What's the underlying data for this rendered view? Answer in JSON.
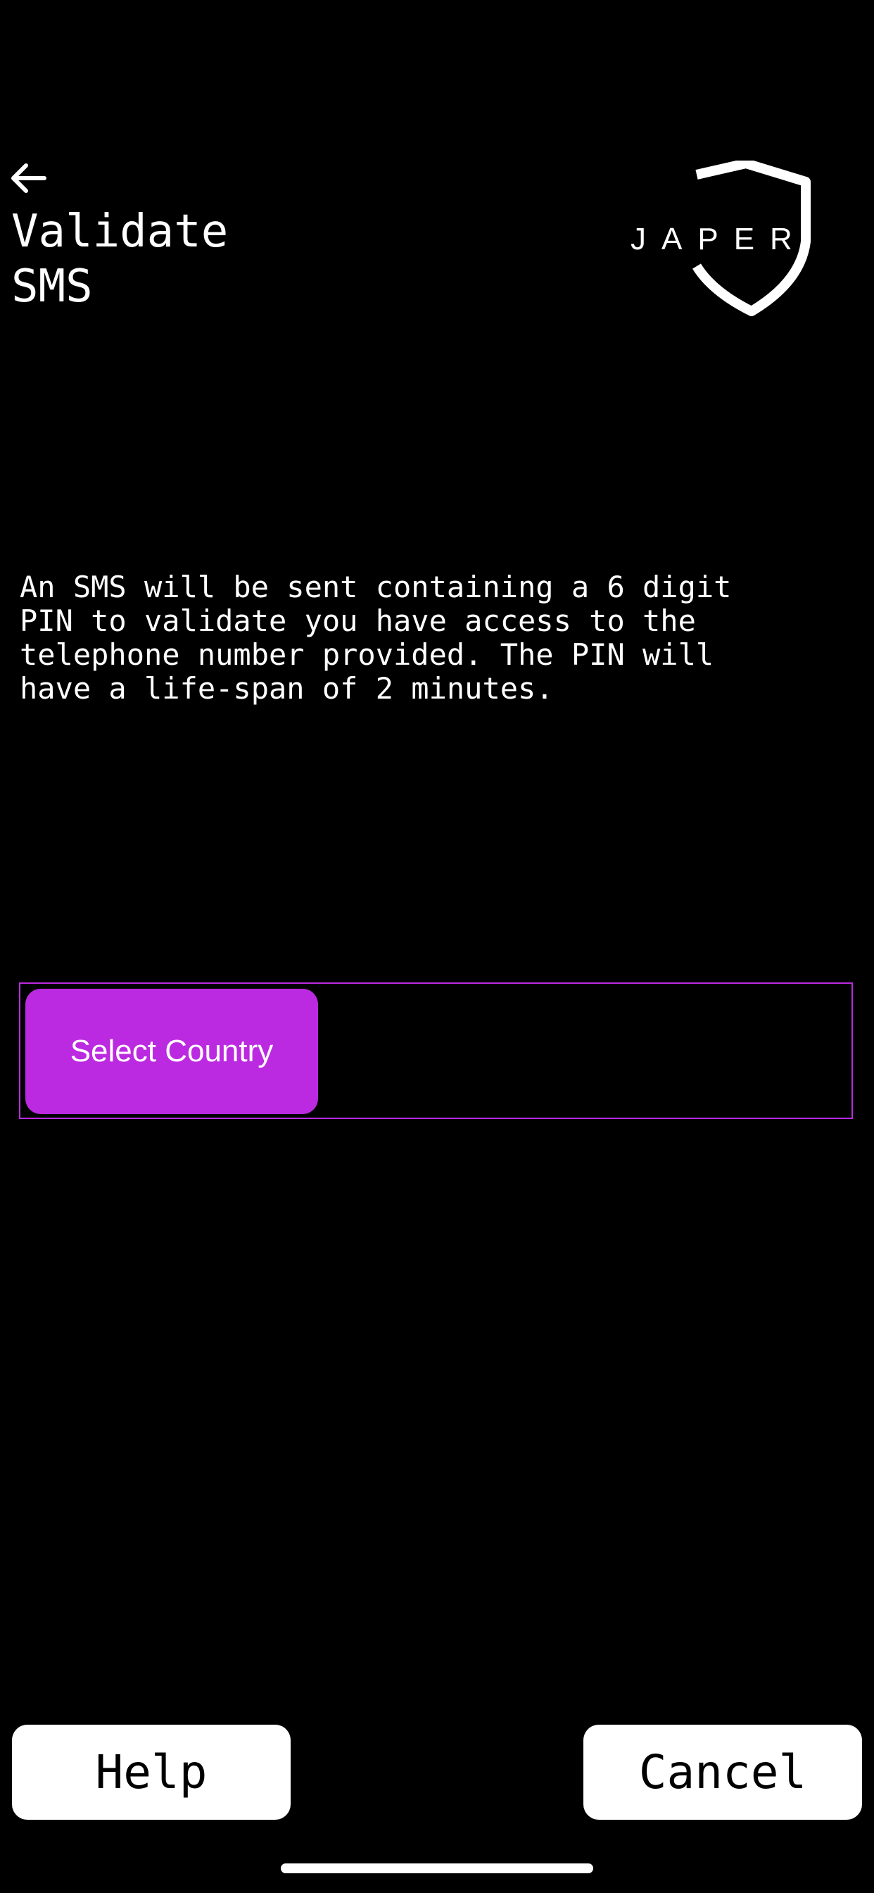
{
  "header": {
    "back_icon": "arrow-left-icon",
    "title_lines": [
      "Validate",
      "SMS"
    ]
  },
  "logo": {
    "text": "JAPER",
    "icon": "shield-icon"
  },
  "description": "An SMS will be sent containing a 6 digit\nPIN to validate you have access to the\ntelephone number provided. The PIN will\nhave a life-span of 2 minutes.",
  "country_selector": {
    "button_label": "Select Country",
    "selected_value": ""
  },
  "footer": {
    "help_label": "Help",
    "cancel_label": "Cancel"
  },
  "colors": {
    "background": "#000000",
    "accent": "#bb2ae0",
    "text": "#ffffff",
    "button_bg": "#ffffff"
  }
}
